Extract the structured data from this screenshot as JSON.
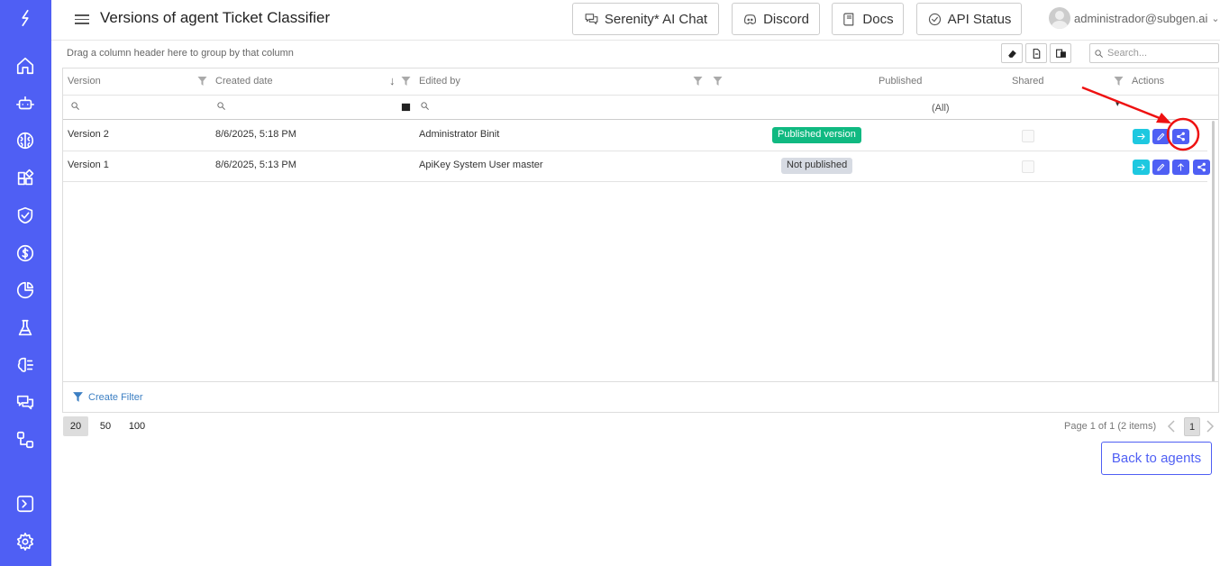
{
  "header": {
    "title": "Versions of agent Ticket Classifier",
    "buttons": [
      "Serenity* AI Chat",
      "Discord",
      "Docs",
      "API Status"
    ],
    "user": "administrador@subgen.ai"
  },
  "sidebar": {
    "items": [
      "logo-icon",
      "home-icon",
      "robot-icon",
      "brain-icon",
      "apps-icon",
      "shield-icon",
      "dollar-icon",
      "pie-chart-icon",
      "flask-icon",
      "ai-brain-icon",
      "chat-icon",
      "workflow-icon",
      "terminal-icon",
      "gear-icon"
    ]
  },
  "toolbar": {
    "group_hint": "Drag a column header here to group by that column",
    "search_placeholder": "Search..."
  },
  "grid": {
    "columns": [
      "Version",
      "Created date",
      "Edited by",
      "Published",
      "Shared",
      "Actions"
    ],
    "published_filter_value": "(All)",
    "rows": [
      {
        "version": "Version 2",
        "created": "8/6/2025, 5:18 PM",
        "edited_by": "Administrator Binit",
        "published": "Published version",
        "published_state": "published",
        "actions": [
          "arrow-right-icon",
          "edit-icon",
          "share-icon"
        ]
      },
      {
        "version": "Version 1",
        "created": "8/6/2025, 5:13 PM",
        "edited_by": "ApiKey System User master",
        "published": "Not published",
        "published_state": "not",
        "actions": [
          "arrow-right-icon",
          "edit-icon",
          "publish-icon",
          "share-icon"
        ]
      }
    ],
    "create_filter": "Create Filter"
  },
  "pager": {
    "sizes": [
      "20",
      "50",
      "100"
    ],
    "selected_size": "20",
    "info": "Page 1 of 1 (2 items)",
    "current_page": "1"
  },
  "back_button": "Back to agents",
  "colors": {
    "accent": "#4f5ff4",
    "published": "#10b981",
    "annotation": "#ee1111"
  }
}
